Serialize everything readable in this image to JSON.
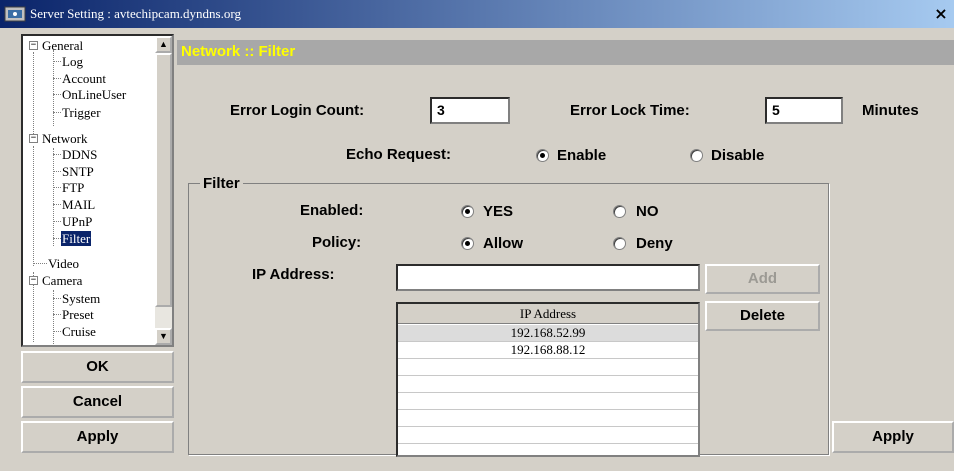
{
  "window": {
    "title": "Server Setting : avtechipcam.dyndns.org",
    "close_label": "×"
  },
  "tree": {
    "general": "General",
    "log": "Log",
    "account": "Account",
    "onlineuser": "OnLineUser",
    "trigger": "Trigger",
    "network": "Network",
    "ddns": "DDNS",
    "sntp": "SNTP",
    "ftp": "FTP",
    "mail": "MAIL",
    "upnp": "UPnP",
    "filter": "Filter",
    "video": "Video",
    "camera": "Camera",
    "system": "System",
    "preset": "Preset",
    "cruise": "Cruise"
  },
  "left_buttons": {
    "ok": "OK",
    "cancel": "Cancel",
    "apply": "Apply"
  },
  "header": {
    "title": "Network :: Filter"
  },
  "form": {
    "error_login_count_label": "Error Login Count:",
    "error_login_count_value": "3",
    "error_lock_time_label": "Error Lock Time:",
    "error_lock_time_value": "5",
    "minutes_label": "Minutes",
    "echo_request_label": "Echo Request:",
    "echo_enable": "Enable",
    "echo_disable": "Disable",
    "echo_selected": "Enable"
  },
  "filter": {
    "group_label": "Filter",
    "enabled_label": "Enabled:",
    "enabled_yes": "YES",
    "enabled_no": "NO",
    "enabled_selected": "YES",
    "policy_label": "Policy:",
    "policy_allow": "Allow",
    "policy_deny": "Deny",
    "policy_selected": "Allow",
    "ip_address_label": "IP Address:",
    "ip_address_value": "",
    "add_label": "Add",
    "delete_label": "Delete",
    "table_header": "IP Address",
    "ips": [
      "192.168.52.99",
      "192.168.88.12"
    ]
  },
  "apply_right": "Apply"
}
